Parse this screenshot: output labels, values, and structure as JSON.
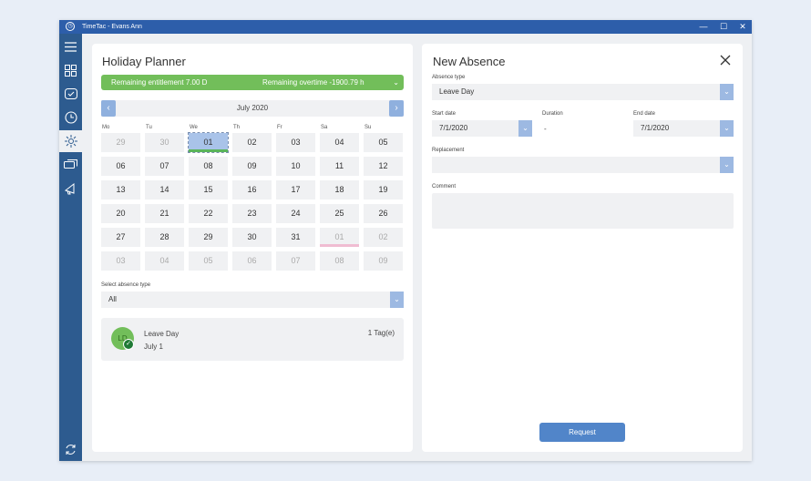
{
  "window": {
    "title": "TimeTac - Evans Ann",
    "app_icon": "timetac-logo-icon"
  },
  "window_controls": {
    "minimize": "—",
    "maximize": "☐",
    "close": "✕"
  },
  "sidebar": {
    "items": [
      {
        "name": "hamburger-menu-icon",
        "active": false
      },
      {
        "name": "dashboard-icon",
        "active": false
      },
      {
        "name": "timer-icon",
        "active": false
      },
      {
        "name": "clock-icon",
        "active": false
      },
      {
        "name": "sun-icon",
        "active": true
      },
      {
        "name": "tickets-icon",
        "active": false
      },
      {
        "name": "megaphone-icon",
        "active": false
      },
      {
        "name": "sync-icon",
        "active": false
      }
    ]
  },
  "planner": {
    "title": "Holiday Planner",
    "banner": {
      "entitlement": "Remaining entitlement 7.00 D",
      "overtime": "Remaining overtime -1900.79 h",
      "chevron": "⌄",
      "color": "#72be5a"
    },
    "calendar": {
      "month": "July 2020",
      "prev": "‹",
      "next": "›",
      "weekdays": [
        "Mo",
        "Tu",
        "We",
        "Th",
        "Fr",
        "Sa",
        "Su"
      ],
      "weeks": [
        [
          {
            "d": "29",
            "other": true
          },
          {
            "d": "30",
            "other": true
          },
          {
            "d": "01",
            "selected": true,
            "mark": "#5ab55a"
          },
          {
            "d": "02"
          },
          {
            "d": "03"
          },
          {
            "d": "04"
          },
          {
            "d": "05"
          }
        ],
        [
          {
            "d": "06"
          },
          {
            "d": "07"
          },
          {
            "d": "08"
          },
          {
            "d": "09"
          },
          {
            "d": "10"
          },
          {
            "d": "11"
          },
          {
            "d": "12"
          }
        ],
        [
          {
            "d": "13"
          },
          {
            "d": "14"
          },
          {
            "d": "15"
          },
          {
            "d": "16"
          },
          {
            "d": "17"
          },
          {
            "d": "18"
          },
          {
            "d": "19"
          }
        ],
        [
          {
            "d": "20"
          },
          {
            "d": "21"
          },
          {
            "d": "22"
          },
          {
            "d": "23"
          },
          {
            "d": "24"
          },
          {
            "d": "25"
          },
          {
            "d": "26"
          }
        ],
        [
          {
            "d": "27"
          },
          {
            "d": "28"
          },
          {
            "d": "29"
          },
          {
            "d": "30"
          },
          {
            "d": "31"
          },
          {
            "d": "01",
            "other": true,
            "mark": "#f0bcd2"
          },
          {
            "d": "02",
            "other": true
          }
        ],
        [
          {
            "d": "03",
            "other": true
          },
          {
            "d": "04",
            "other": true
          },
          {
            "d": "05",
            "other": true
          },
          {
            "d": "06",
            "other": true
          },
          {
            "d": "07",
            "other": true
          },
          {
            "d": "08",
            "other": true
          },
          {
            "d": "09",
            "other": true
          }
        ]
      ]
    },
    "absence_type_label": "Select absence type",
    "absence_type_value": "All",
    "absence_item": {
      "initials": "LD",
      "check": "✓",
      "name": "Leave Day",
      "date": "July 1",
      "tags": "1 Tag(e)"
    }
  },
  "new_absence": {
    "title": "New Absence",
    "absence_type_label": "Absence type",
    "absence_type_value": "Leave Day",
    "start_date_label": "Start date",
    "start_date_value": "7/1/2020",
    "duration_label": "Duration",
    "duration_value": "-",
    "end_date_label": "End date",
    "end_date_value": "7/1/2020",
    "replacement_label": "Replacement",
    "replacement_value": "",
    "comment_label": "Comment",
    "comment_value": "",
    "request_button": "Request",
    "dropdown_chevron": "⌄",
    "accent_color": "#5185c9"
  }
}
